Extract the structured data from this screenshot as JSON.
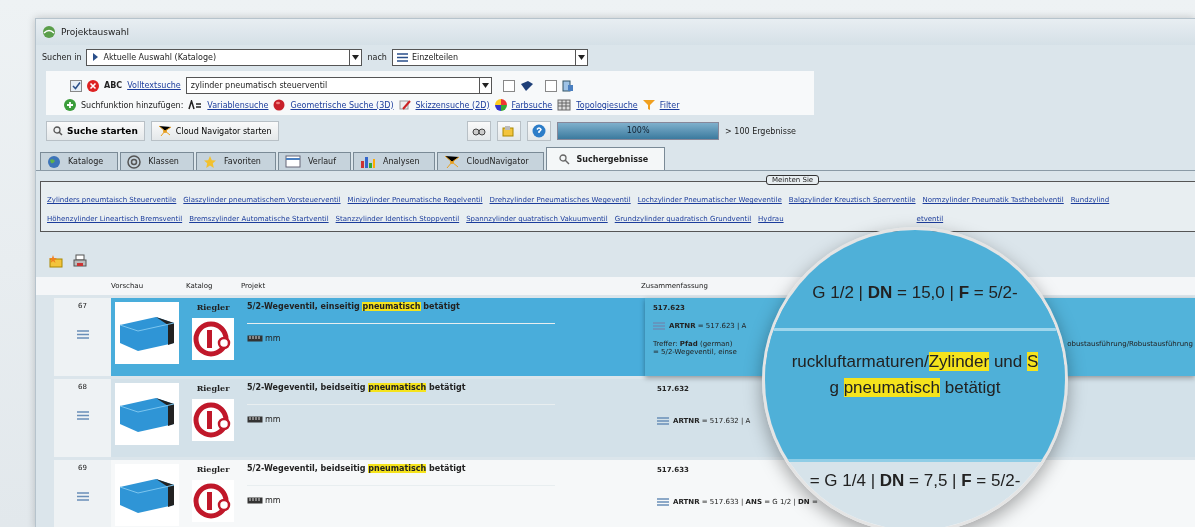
{
  "window": {
    "title": "Projektauswahl"
  },
  "search_scope": {
    "label": "Suchen in",
    "scope": "Aktuelle Auswahl (Kataloge)",
    "connector": "nach",
    "target": "Einzelteilen"
  },
  "fulltext": {
    "checked": true,
    "tag": "ABC",
    "link": "Volltextsuche",
    "value": "zylinder pneumatisch steuerventil",
    "options": [
      {
        "checked": false
      },
      {
        "checked": false
      }
    ]
  },
  "add_functions": {
    "label": "Suchfunktion hinzufügen:",
    "links": [
      "Variablensuche",
      "Geometrische Suche (3D)",
      "Skizzensuche (2D)",
      "Farbsuche",
      "Topologiesuche",
      "Filter"
    ]
  },
  "actions": {
    "search": "Suche starten",
    "cloud": "Cloud Navigator starten",
    "progress": {
      "level": 1,
      "text": "100%"
    },
    "results": "> 100 Ergebnisse"
  },
  "tabs": [
    {
      "label": "Kataloge",
      "selected": false
    },
    {
      "label": "Klassen",
      "selected": false
    },
    {
      "label": "Favoriten",
      "selected": false
    },
    {
      "label": "Verlauf",
      "selected": false
    },
    {
      "label": "Analysen",
      "selected": false
    },
    {
      "label": "CloudNavigator",
      "selected": false
    },
    {
      "label": "Suchergebnisse",
      "selected": true
    }
  ],
  "suggestions": {
    "title": "Meinten Sie",
    "links": [
      "Zylinders pneumtaisch Steuerventile",
      "Glaszylinder pneumatischem Vorsteuerventil",
      "Minizylinder Pneumatische Regelventil",
      "Drehzylinder Pneumatisches Wegeventil",
      "Lochzylinder Pneumatischer Wegeventile",
      "Balgzylinder Kreuztisch Sperrventile",
      "Normzylinder Pneumatik Tasthebelventil",
      "Rundzylind",
      "Höhenzylinder Lineartisch Bremsventil",
      "Bremszylinder Automatische Startventil",
      "Stanzzylinder Identisch Stoppventil",
      "Spannzylinder quatratisch Vakuumventil",
      "Grundzylinder quadratisch Grundventil",
      "Hydrau",
      "etventil"
    ]
  },
  "table": {
    "columns": [
      "Vorschau",
      "Katalog",
      "Projekt",
      "Zusammenfassung"
    ],
    "rows": [
      {
        "number": "67",
        "selected": true,
        "catalog": "Riegler",
        "title": [
          {
            "text": "5/2-Wegeventil, einseitig ",
            "highlight": false
          },
          {
            "text": "pneumatisch",
            "highlight": true
          },
          {
            "text": " betätigt",
            "highlight": false
          }
        ],
        "unit": "mm",
        "code": "517.623",
        "summary": "**ARTNR** = 517.623 | A",
        "hit_left": "Treffer: **Pfad** (german)",
        "hit_right": "obustausführung/Robustausführung",
        "hit_line2": "= 5/2-Wegeventil, einse"
      },
      {
        "number": "68",
        "selected": false,
        "catalog": "Riegler",
        "title": [
          {
            "text": "5/2-Wegeventil, beidseitig ",
            "highlight": false
          },
          {
            "text": "pneumatisch",
            "highlight": true
          },
          {
            "text": " betätigt",
            "highlight": false
          }
        ],
        "unit": "mm",
        "code": "517.632",
        "summary": "**ARTNR** = 517.632 | A"
      },
      {
        "number": "69",
        "selected": false,
        "catalog": "Riegler",
        "title": [
          {
            "text": "5/2-Wegeventil, beidseitig ",
            "highlight": false
          },
          {
            "text": "pneumatisch",
            "highlight": true
          },
          {
            "text": " betätigt",
            "highlight": false
          }
        ],
        "unit": "mm",
        "code": "517.633",
        "summary": "**ARTNR** = 517.633 | **ANS** = G 1/2 | **DN** ="
      }
    ]
  },
  "magnifier": {
    "lines": [
      {
        "kind": "top",
        "parts": [
          {
            "text": "G 1/2 | **DN** = 15,0 | **F** = 5/2-",
            "highlight": false
          }
        ]
      },
      {
        "kind": "hit",
        "parts": [
          {
            "text": "ruckluftarmaturen/",
            "highlight": false
          },
          {
            "text": "Zylinder",
            "highlight": true
          },
          {
            "text": " und ",
            "highlight": false
          },
          {
            "text": "S",
            "highlight": true
          }
        ]
      },
      {
        "kind": "hit",
        "parts": [
          {
            "text": "g ",
            "highlight": false
          },
          {
            "text": "pneumatisch",
            "highlight": true
          },
          {
            "text": " betätigt",
            "highlight": false
          }
        ]
      },
      {
        "kind": "bottom",
        "parts": [
          {
            "text": "= G 1/4 | **DN** = 7,5 | **F** = 5/2-",
            "highlight": false
          }
        ]
      }
    ]
  }
}
